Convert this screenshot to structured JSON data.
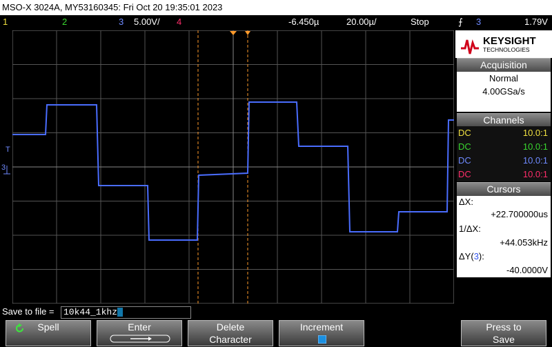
{
  "title": "MSO-X 3024A, MY53160345: Fri Oct 20 19:35:01 2023",
  "channel_bar": {
    "ch1": "1",
    "ch2": "2",
    "ch3": "3",
    "ch3_scale": "5.00V/",
    "ch4": "4",
    "time_offset": "-6.450µ",
    "time_scale": "20.00µ/",
    "run_state": "Stop",
    "trigger_channel": "3",
    "trigger_level": "1.79V"
  },
  "logo": {
    "brand": "KEYSIGHT",
    "sub": "TECHNOLOGIES"
  },
  "acquisition": {
    "heading": "Acquisition",
    "mode": "Normal",
    "rate": "4.00GSa/s"
  },
  "channels": {
    "heading": "Channels",
    "rows": [
      {
        "coupling": "DC",
        "probe": "10.0:1",
        "color": "#f0e040"
      },
      {
        "coupling": "DC",
        "probe": "10.0:1",
        "color": "#39d82f"
      },
      {
        "coupling": "DC",
        "probe": "10.0:1",
        "color": "#6f8aff"
      },
      {
        "coupling": "DC",
        "probe": "10.0:1",
        "color": "#ff2d6a"
      }
    ]
  },
  "cursors": {
    "heading": "Cursors",
    "dx_label": "ΔX:",
    "dx_value": "+22.700000us",
    "inv_dx_label": "1/ΔX:",
    "inv_dx_value": "+44.053kHz",
    "dy_label": "ΔY(",
    "dy_channel": "3",
    "dy_label_end": "):",
    "dy_value": "-40.0000V"
  },
  "save": {
    "label": "Save to file =",
    "filename": "10k44_1khz"
  },
  "softkeys": {
    "spell": "Spell",
    "enter": "Enter",
    "delete_1": "Delete",
    "delete_2": "Character",
    "increment": "Increment",
    "press_1": "Press to",
    "press_2": "Save"
  },
  "colors": {
    "ch1": "#f0e040",
    "ch2": "#39d82f",
    "ch3": "#5577ff",
    "ch4": "#ff2d6a",
    "cursor": "#ff9a2a"
  }
}
